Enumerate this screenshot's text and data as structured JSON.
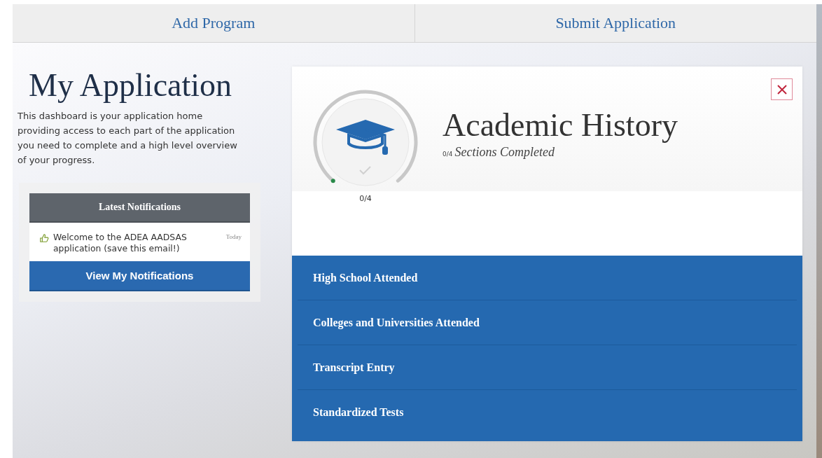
{
  "nav": [
    {
      "label": "Add Program"
    },
    {
      "label": "Submit Application"
    }
  ],
  "title": "My Application",
  "intro": "This dashboard is your application home providing access to each part of the application you need to complete and a high level overview of your progress.",
  "notifications": {
    "heading": "Latest Notifications",
    "items": [
      {
        "text": "Welcome to the ADEA AADSAS application (save this email!)",
        "time": "Today"
      }
    ],
    "button": "View My Notifications"
  },
  "panel": {
    "title": "Academic History",
    "count": "0/4",
    "subtitle": "Sections Completed",
    "ring": {
      "label": "0/4"
    },
    "sections": [
      {
        "label": "High School Attended"
      },
      {
        "label": "Colleges and Universities Attended"
      },
      {
        "label": "Transcript Entry"
      },
      {
        "label": "Standardized Tests"
      }
    ]
  }
}
